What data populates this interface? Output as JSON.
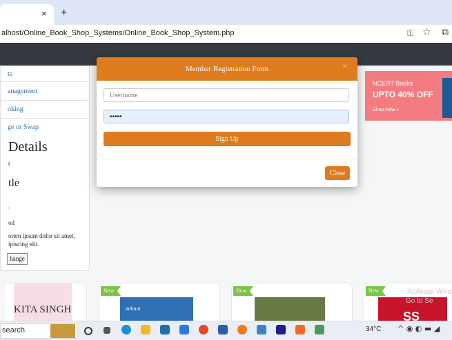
{
  "browser": {
    "tab_close": "×",
    "new_tab": "+",
    "url": "alhost/Online_Book_Shop_Systems/Online_Book_Shop_System.php",
    "key_icon": "key-icon",
    "star_icon": "star-icon"
  },
  "sidebar": {
    "links": [
      "ts",
      "anagement",
      "oking",
      "ge or Swap"
    ],
    "details_heading": "Details",
    "details_sub": "r",
    "title_heading": "tle",
    "dash": "-",
    "od": "od",
    "lorem": "orem ipsum dolor sit amet, ipiscing elit.",
    "change_label": "hange"
  },
  "promo": {
    "small": "NCERT Books",
    "big": "UPTO 40% OFF",
    "shop": "Shop Now »"
  },
  "cards": {
    "badge": "New",
    "kita": "KITA SINGH",
    "arihant": "arihant",
    "ss": "SS",
    "activate": "Activate Windows",
    "goto": "Go to Se"
  },
  "modal": {
    "title": "Member Registration Form",
    "close_x": "×",
    "username_placeholder": "Username",
    "password_value": "•••••",
    "signup_label": "Sign Up",
    "close_label": "Close"
  },
  "taskbar": {
    "search": "search",
    "weather": "34°C",
    "tray": "^ ◉ ◐ ▬ ◢"
  },
  "colors": {
    "accent": "#e07b1d",
    "nav": "#343a40",
    "promo": "#f47c80",
    "badge": "#7cc444"
  }
}
